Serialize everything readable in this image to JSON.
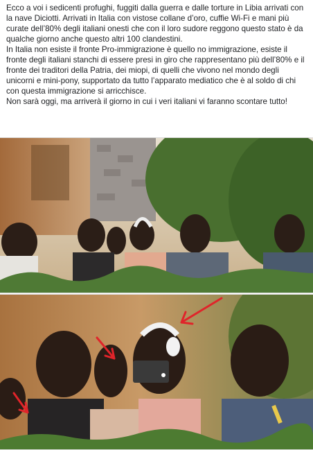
{
  "post": {
    "paragraphs": [
      "Ecco a voi i sedicenti profughi, fuggiti dalla guerra e dalle torture in Libia arrivati con la nave Diciotti. Arrivati in Italia con vistose collane d’oro, cuffie Wi-Fi e mani più curate dell’80% degli italiani onesti che con il loro sudore reggono questo stato è da qualche giorno anche questo altri 100 clandestini.",
      "In Italia non esiste il fronte Pro-immigrazione è quello no immigrazione, esiste il fronte degli italiani stanchi di essere presi in giro che rappresentano più dell’80% e il fronte dei traditori della Patria, dei miopi, di quelli che vivono nel mondo degli unicorni e mini-pony, supportato da tutto l’apparato mediatico che è al soldo di chi con questa immigrazione si arricchisce.",
      "Non sarà oggi, ma arriverà il giorno in cui i veri italiani vi faranno scontare tutto!"
    ]
  },
  "photos": {
    "top": {
      "description_icon": "group-photo-icon"
    },
    "bottom": {
      "description_icon": "zoomed-photo-icon",
      "arrow_color": "#e0242a"
    }
  },
  "colors": {
    "text": "#1c1e21",
    "hedge": "#3f6b2a",
    "wall": "#b98a5a",
    "sky": "#d9d2c3"
  }
}
